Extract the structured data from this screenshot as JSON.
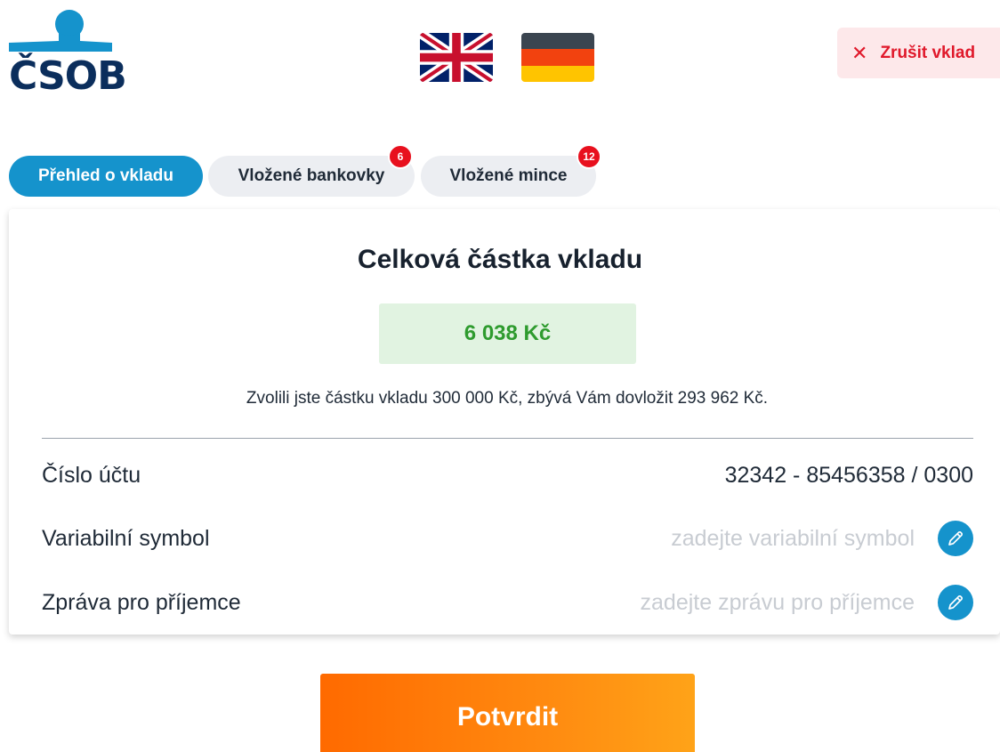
{
  "header": {
    "logo_text": "ČSOB",
    "languages": [
      {
        "code": "en",
        "icon": "uk-flag-icon"
      },
      {
        "code": "de",
        "icon": "german-flag-icon"
      }
    ],
    "cancel_label": "Zrušit vklad",
    "cancel_icon": "close-icon"
  },
  "tabs": [
    {
      "label": "Přehled o vkladu",
      "active": true
    },
    {
      "label": "Vložené bankovky",
      "badge": "6"
    },
    {
      "label": "Vložené mince",
      "badge": "12"
    }
  ],
  "summary": {
    "title": "Celková částka vkladu",
    "amount": "6 038 Kč",
    "info": "Zvolili jste částku vkladu 300 000 Kč, zbývá Vám dovložit 293 962 Kč."
  },
  "fields": {
    "account": {
      "label": "Číslo účtu",
      "value": "32342 - 85456358 / 0300"
    },
    "variable_symbol": {
      "label": "Variabilní symbol",
      "placeholder": "zadejte variabilní symbol",
      "icon": "pencil-icon"
    },
    "message": {
      "label": "Zpráva pro příjemce",
      "placeholder": "zadejte zprávu pro příjemce",
      "icon": "pencil-icon"
    }
  },
  "confirm_label": "Potvrdit",
  "colors": {
    "accent": "#1593cc",
    "brand_navy": "#0b2e5c",
    "cancel_red": "#e0192b",
    "amount_green": "#2e9b2e",
    "confirm_orange": "#ff6a00",
    "badge_red": "#e8101e"
  }
}
